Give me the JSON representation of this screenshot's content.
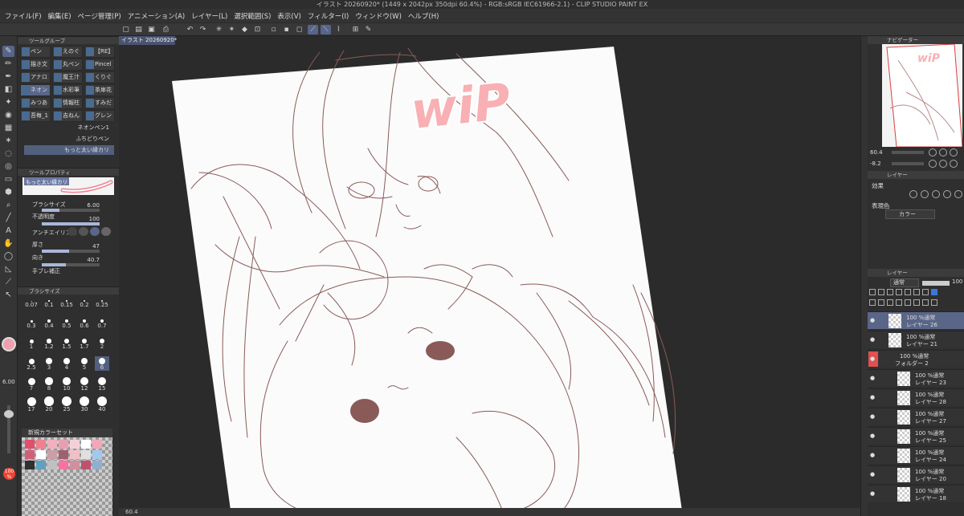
{
  "title": "イラスト 20260920* (1449 x 2042px 350dpi 60.4%) - RGB:sRGB IEC61966-2.1) - CLIP STUDIO PAINT EX",
  "menu": [
    "ファイル(F)",
    "編集(E)",
    "ページ管理(P)",
    "アニメーション(A)",
    "レイヤー(L)",
    "選択範囲(S)",
    "表示(V)",
    "フィルター(I)",
    "ウィンドウ(W)",
    "ヘルプ(H)"
  ],
  "tool_group": {
    "header": "ツールグループ",
    "subtools": [
      "ペン",
      "えのぐ",
      "【RE】",
      "描き文",
      "丸ペン",
      "Pincel",
      "アナロ",
      "魔王汁",
      "くりぐ",
      "ネオン",
      "水彩筆",
      "茶扉花",
      "みつあ",
      "情報柱",
      "すみだ",
      "吾毎_1",
      "吉ねん",
      "グレン"
    ],
    "brushes": [
      "ネオンペン1",
      "ふちどりペン",
      "もっと太い縁カリ"
    ]
  },
  "tool_property": {
    "header": "ツールプロパティ",
    "brush_name": "もっと太い縁カリ",
    "brush_size_label": "ブラシサイズ",
    "brush_size_value": "6.00",
    "opacity_label": "不透明度",
    "opacity_value": "100",
    "antialias_label": "アンチエイリアス",
    "thickness_label": "厚さ",
    "thickness_value": "47",
    "direction_label": "向き",
    "direction_value": "40.7",
    "stabilization_label": "手ブレ補正",
    "brush_size_fill": 0.3,
    "opacity_fill": 1.0,
    "thickness_fill": 0.47,
    "direction_fill": 0.41
  },
  "brush_size_panel": {
    "header": "ブラシサイズ",
    "sizes": [
      "0.07",
      "0.1",
      "0.15",
      "0.2",
      "0.25",
      "0.3",
      "0.4",
      "0.5",
      "0.6",
      "0.7",
      "1",
      "1.2",
      "1.5",
      "1.7",
      "2",
      "2.5",
      "3",
      "4",
      "5",
      "6",
      "7",
      "8",
      "10",
      "12",
      "15",
      "17",
      "20",
      "25",
      "30",
      "40"
    ],
    "selected": "6"
  },
  "toolbar_status": {
    "size_value": "6.00",
    "opacity_badge": "100 %"
  },
  "color_set": {
    "name": "新規カラーセット",
    "colors": [
      "#e0506a",
      "#f08090",
      "#f0b0c0",
      "#e8a0b0",
      "#f6d0d8",
      "#ffffff",
      "#f4a6b8",
      "#d06078",
      "#ffffff",
      "#caa0a8",
      "#a06070",
      "#f0c0c8",
      "#e0e0e0",
      "#a0c8f0",
      "#303030",
      "#60a0c0",
      "#c0c0c0",
      "#ff70a0",
      "#d090a0",
      "#c05070",
      "#90b0d0"
    ]
  },
  "doc_tab": "イラスト 20260920*",
  "canvas": {
    "watermark": "wiP"
  },
  "status_bar": "60.4",
  "right_panel": {
    "navigator_header": "ナビゲーター",
    "zoom": "60.4",
    "rotate": "-8.2",
    "layer_property_header": "レイヤー",
    "effect_label": "効果",
    "expression_label": "表現色",
    "color_mode": "カラー",
    "layers_header": "レイヤー",
    "blend_mode": "通常",
    "layer_opacity": "100",
    "layers": [
      {
        "mode": "100 %通常",
        "name": "レイヤー 26",
        "selected": true,
        "type": "layer",
        "indent": false
      },
      {
        "mode": "100 %通常",
        "name": "レイヤー 21",
        "selected": false,
        "type": "layer",
        "indent": false
      },
      {
        "mode": "100 %通常",
        "name": "フォルダー 2",
        "selected": false,
        "type": "folder",
        "indent": false
      },
      {
        "mode": "100 %通常",
        "name": "レイヤー 23",
        "selected": false,
        "type": "layer",
        "indent": true
      },
      {
        "mode": "100 %通常",
        "name": "レイヤー 28",
        "selected": false,
        "type": "layer",
        "indent": true
      },
      {
        "mode": "100 %通常",
        "name": "レイヤー 27",
        "selected": false,
        "type": "layer",
        "indent": true
      },
      {
        "mode": "100 %通常",
        "name": "レイヤー 25",
        "selected": false,
        "type": "layer",
        "indent": true
      },
      {
        "mode": "100 %通常",
        "name": "レイヤー 24",
        "selected": false,
        "type": "layer",
        "indent": true
      },
      {
        "mode": "100 %通常",
        "name": "レイヤー 20",
        "selected": false,
        "type": "layer",
        "indent": true
      },
      {
        "mode": "100 %通常",
        "name": "レイヤー 18",
        "selected": false,
        "type": "layer",
        "indent": true
      }
    ]
  },
  "colors": {
    "accent": "#56658a",
    "main_color": "#f0a0ad",
    "line_art": "#8a5a58",
    "watermark_fill": "#f8b0b4"
  }
}
